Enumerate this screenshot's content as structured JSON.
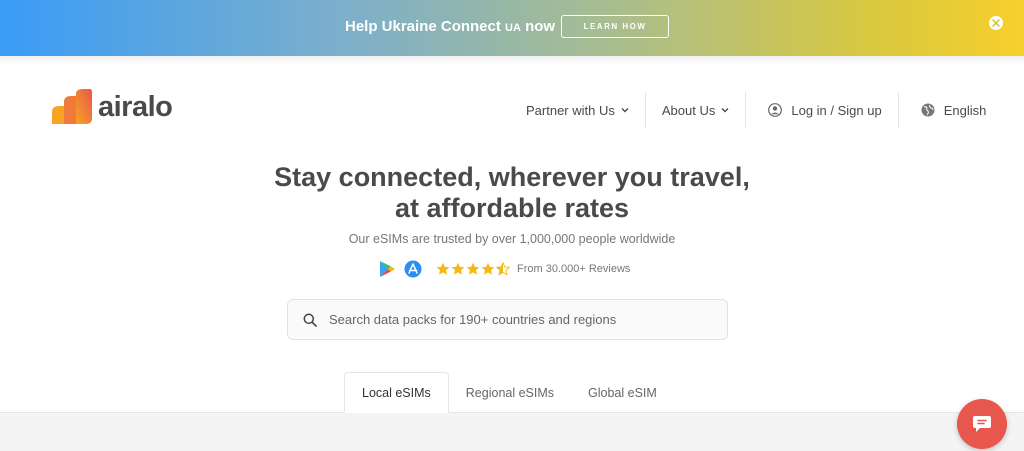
{
  "banner": {
    "text": "Help Ukraine Connect",
    "text_suffix": "UA",
    "text_end": " now",
    "button_label": "LEARN HOW",
    "close_icon": "close-icon"
  },
  "header": {
    "logo_text": "airalo",
    "nav": [
      {
        "label": "Partner with Us",
        "icon": "chevron-down-icon"
      },
      {
        "label": "About Us",
        "icon": "chevron-down-icon"
      },
      {
        "label": "Log in / Sign up",
        "icon": "user-icon"
      },
      {
        "label": "English",
        "icon": "globe-icon"
      }
    ]
  },
  "hero": {
    "title_line1": "Stay connected, wherever you travel,",
    "title_line2": "at affordable rates",
    "subtitle": "Our eSIMs are trusted by over 1,000,000 people worldwide",
    "rating_stars": 4.5,
    "reviews_text": "From 30.000+ Reviews"
  },
  "search": {
    "placeholder": "Search data packs for 190+ countries and regions"
  },
  "tabs": [
    {
      "label": "Local eSIMs",
      "active": true
    },
    {
      "label": "Regional eSIMs",
      "active": false
    },
    {
      "label": "Global eSIM",
      "active": false
    }
  ],
  "colors": {
    "accent": "#e8574d",
    "star": "#f5b90f",
    "text": "#4a4a4a"
  }
}
